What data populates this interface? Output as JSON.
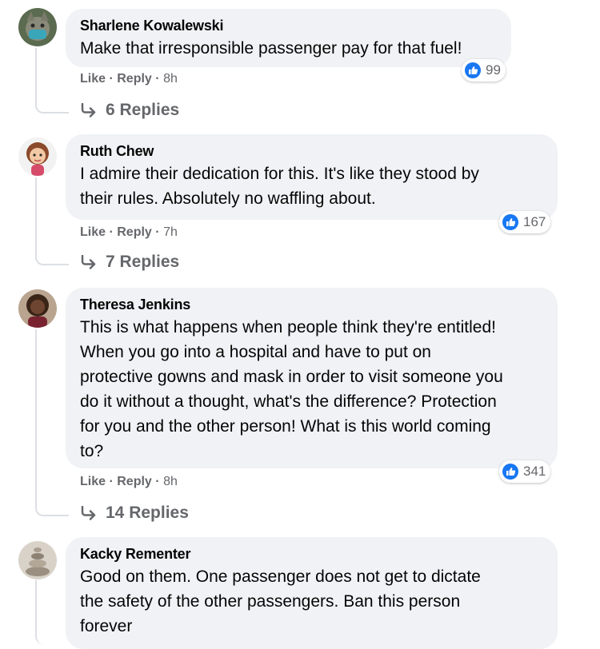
{
  "comments": [
    {
      "author": "Sharlene Kowalewski",
      "text": "Make that irresponsible passenger pay for that fuel!",
      "like_label": "Like",
      "reply_label": "Reply",
      "time": "8h",
      "reaction_count": "99",
      "replies_label": "6 Replies",
      "avatar_icon": "avatar-cat-with-mask-icon"
    },
    {
      "author": "Ruth Chew",
      "text_lines": [
        "I admire their dedication for this. It's like they stood by",
        "their rules. Absolutely no waffling about."
      ],
      "like_label": "Like",
      "reply_label": "Reply",
      "time": "7h",
      "reaction_count": "167",
      "replies_label": "7 Replies",
      "avatar_icon": "avatar-cartoon-woman-icon"
    },
    {
      "author": "Theresa Jenkins",
      "text_lines": [
        "This is what happens when people think they're entitled!",
        "When you go into a hospital and have to put on",
        "protective gowns and mask in order to visit someone you",
        "do it without a thought, what's the difference? Protection",
        "for you and the other person! What is this world coming",
        "to?"
      ],
      "like_label": "Like",
      "reply_label": "Reply",
      "time": "8h",
      "reaction_count": "341",
      "replies_label": "14 Replies",
      "avatar_icon": "avatar-woman-photo-icon"
    },
    {
      "author": "Kacky Rementer",
      "text_lines": [
        "Good on them. One passenger does not get to dictate",
        "the safety of the other passengers. Ban this person",
        "forever"
      ],
      "avatar_icon": "avatar-stones-photo-icon"
    }
  ],
  "colors": {
    "bubble": "#f0f2f5",
    "meta": "#65676b",
    "like_blue": "#1877f2"
  }
}
